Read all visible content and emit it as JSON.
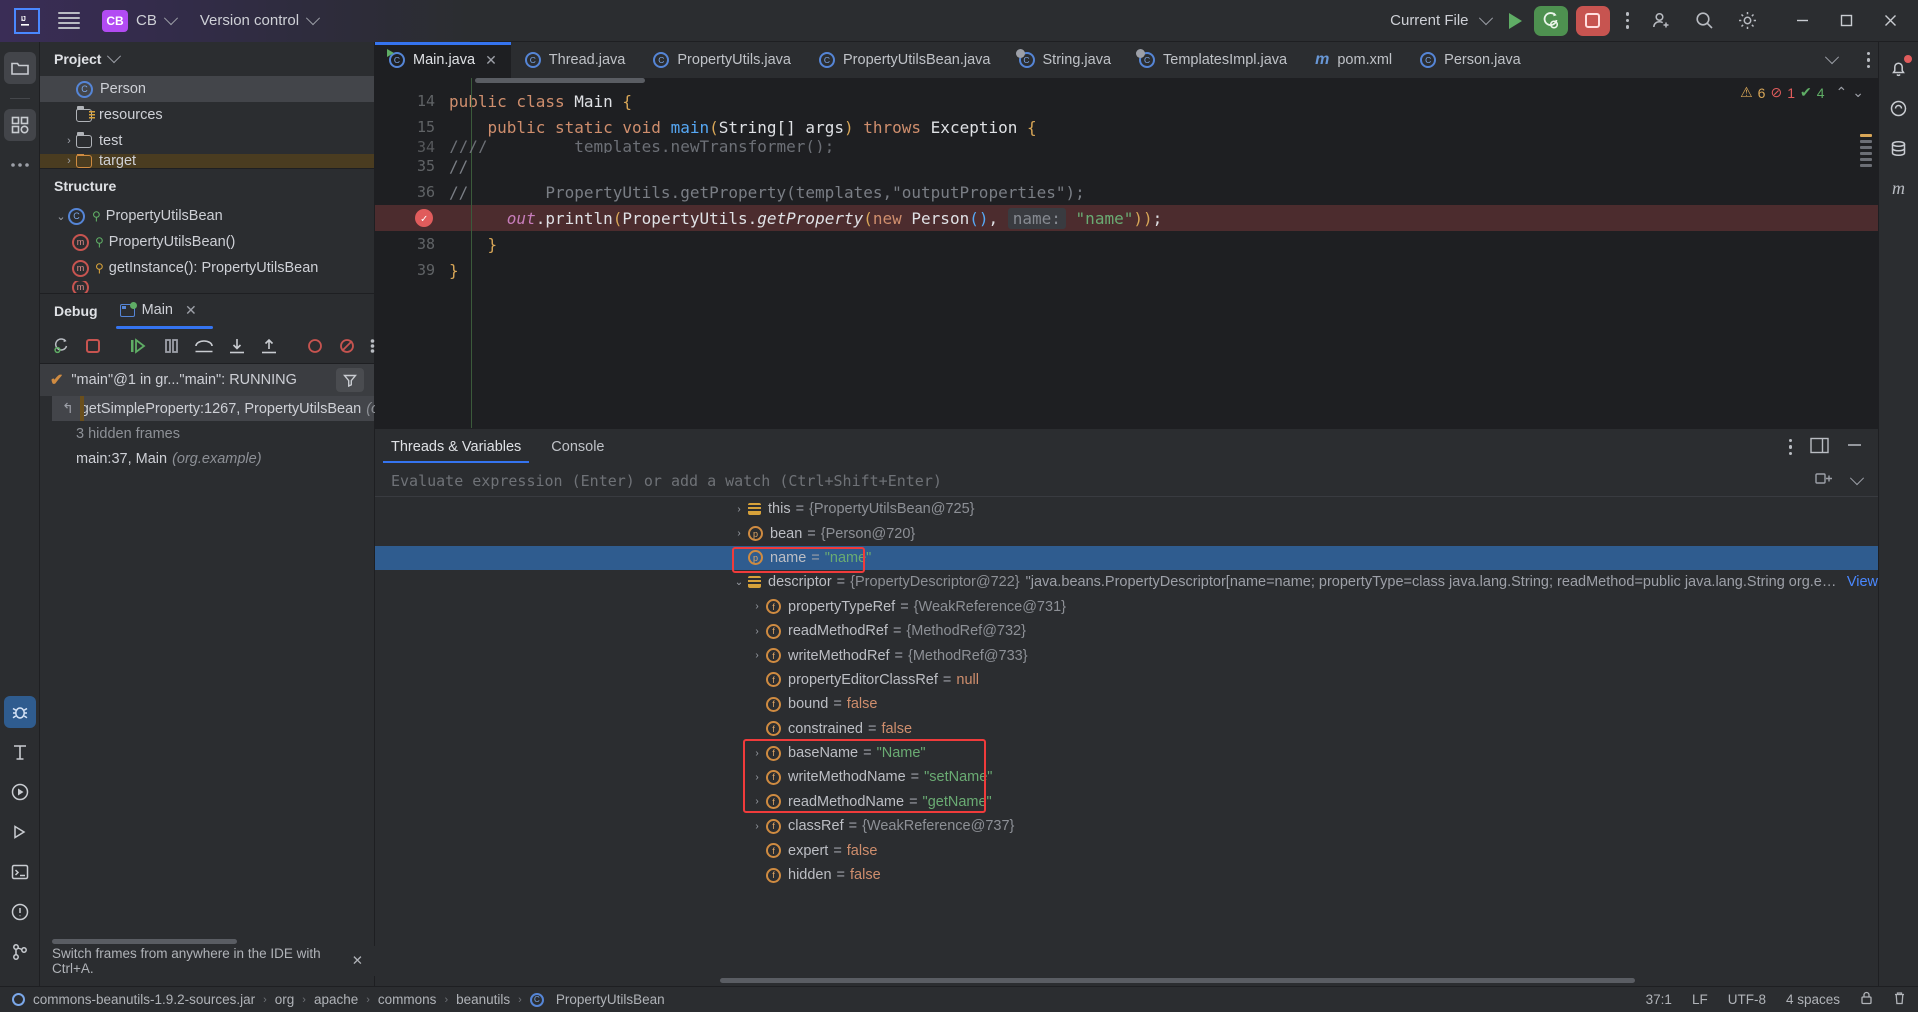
{
  "titlebar": {
    "logo": "IJ",
    "menu_icon": "hamburger-menu-icon",
    "project_badge": "CB",
    "project_name": "CB",
    "vcs_label": "Version control",
    "run_config": "Current File",
    "run_icon": "run-triangle-icon",
    "debug_icon": "debug-bug-icon",
    "stop_icon": "stop-square-icon",
    "more_icon": "more-vertical-icon",
    "account_icon": "account-add-icon",
    "search_icon": "search-icon",
    "settings_icon": "gear-icon",
    "minimize": "—",
    "maximize": "❐",
    "close": "✕",
    "accent_green": "#4e9150",
    "accent_red": "#c75450",
    "accent_purple": "#b24bf3"
  },
  "rail": {
    "project_icon": "folder-icon",
    "structure_icon": "structure-grid-icon",
    "more_icon": "more-horizontal-icon",
    "debug_icon": "debug-bug-icon",
    "todo_icon": "todo-icon",
    "run_icon": "run-icon",
    "services_icon": "services-play-icon",
    "terminal_icon": "terminal-icon",
    "problems_icon": "problems-warning-icon",
    "vcs_icon": "git-branch-icon"
  },
  "project_panel": {
    "title": "Project",
    "chevron": "chevron-down-icon",
    "items": [
      {
        "label": "Person",
        "icon": "class-icon",
        "indent": 2,
        "state": "selected",
        "arrow": ""
      },
      {
        "label": "resources",
        "icon": "resource-folder-icon",
        "indent": 2,
        "state": "normal",
        "arrow": ""
      },
      {
        "label": "test",
        "icon": "folder-icon",
        "indent": 1,
        "state": "normal",
        "arrow": "›"
      },
      {
        "label": "target",
        "icon": "folder-orange-icon",
        "indent": 1,
        "state": "highlighted",
        "arrow": "›"
      }
    ]
  },
  "structure_panel": {
    "title": "Structure",
    "items": [
      {
        "label": "PropertyUtilsBean",
        "icon": "class-icon",
        "visibility": "public-key-icon",
        "indent": 0,
        "arrow": "⌄"
      },
      {
        "label": "PropertyUtilsBean()",
        "icon": "method-icon",
        "visibility": "public-key-icon",
        "indent": 1,
        "arrow": ""
      },
      {
        "label": "getInstance(): PropertyUtilsBean",
        "icon": "method-icon",
        "visibility": "protected-key-icon",
        "indent": 1,
        "arrow": ""
      }
    ]
  },
  "debug_panel": {
    "title": "Debug",
    "tab_label": "Main",
    "tab_icon": "run-config-icon",
    "tab_close": "✕",
    "toolbar": [
      {
        "name": "rerun-button",
        "icon": "rerun-icon"
      },
      {
        "name": "stop-button",
        "icon": "stop-icon"
      },
      {
        "name": "resume-button",
        "icon": "resume-icon"
      },
      {
        "name": "pause-button",
        "icon": "pause-icon"
      },
      {
        "name": "step-over-button",
        "icon": "step-over-icon"
      },
      {
        "name": "step-into-button",
        "icon": "step-into-icon"
      },
      {
        "name": "step-out-button",
        "icon": "step-out-icon"
      },
      {
        "name": "mute-breakpoints-button",
        "icon": "breakpoint-circle-icon"
      },
      {
        "name": "view-breakpoints-button",
        "icon": "breakpoint-muted-icon"
      },
      {
        "name": "more-button",
        "icon": "more-vertical-icon"
      }
    ],
    "thread_row": "\"main\"@1 in gr...\"main\": RUNNING",
    "thread_check": "✔",
    "filter_icon": "filter-icon",
    "frames": [
      {
        "label": "getSimpleProperty:1267, PropertyUtilsBean",
        "suffix": "(org",
        "state": "selected"
      },
      {
        "label": "3 hidden frames",
        "suffix": "",
        "state": "dim"
      },
      {
        "label": "main:37, Main",
        "suffix": "(org.example)",
        "state": "normal"
      }
    ],
    "tip_text": "Switch frames from anywhere in the IDE with Ctrl+A.",
    "tip_close": "✕"
  },
  "editor": {
    "tabs": [
      {
        "label": "Main.java",
        "icon": "java-class-run-icon",
        "active": true,
        "closable": true
      },
      {
        "label": "Thread.java",
        "icon": "java-class-icon",
        "active": false,
        "closable": false
      },
      {
        "label": "PropertyUtils.java",
        "icon": "java-class-icon",
        "active": false,
        "closable": false
      },
      {
        "label": "PropertyUtilsBean.java",
        "icon": "java-class-icon",
        "active": false,
        "closable": false
      },
      {
        "label": "String.java",
        "icon": "java-class-lib-icon",
        "active": false,
        "closable": false
      },
      {
        "label": "TemplatesImpl.java",
        "icon": "java-class-lib-icon",
        "active": false,
        "closable": false
      },
      {
        "label": "pom.xml",
        "icon": "maven-icon",
        "active": false,
        "closable": false
      },
      {
        "label": "Person.java",
        "icon": "java-class-icon",
        "active": false,
        "closable": false
      }
    ],
    "tabs_overflow_icon": "chevron-down-icon",
    "tabs_more_icon": "more-vertical-icon",
    "notification_icon": "bell-icon",
    "inspections": {
      "warnings": "6",
      "errors": "1",
      "checks": "4",
      "warning_icon": "warning-triangle-icon",
      "error_icon": "error-circle-icon",
      "ok_icon": "check-icon",
      "up_icon": "chevron-up-icon",
      "down_icon": "chevron-down-icon"
    },
    "lines": [
      {
        "num": "14",
        "breakpoint": false,
        "tokens": [
          {
            "t": "public ",
            "c": "k"
          },
          {
            "t": "class ",
            "c": "k"
          },
          {
            "t": "Main ",
            "c": ""
          },
          {
            "t": "{",
            "c": "y"
          }
        ]
      },
      {
        "num": "15",
        "breakpoint": false,
        "indent": 2,
        "tokens": [
          {
            "t": "public ",
            "c": "k"
          },
          {
            "t": "static ",
            "c": "k"
          },
          {
            "t": "void ",
            "c": "k"
          },
          {
            "t": "main",
            "c": "fn"
          },
          {
            "t": "(",
            "c": "y"
          },
          {
            "t": "String[] args",
            "c": ""
          },
          {
            "t": ")",
            "c": "y"
          },
          {
            "t": " throws ",
            "c": "k"
          },
          {
            "t": "Exception ",
            "c": ""
          },
          {
            "t": "{",
            "c": "y"
          }
        ]
      },
      {
        "num": "34",
        "breakpoint": false,
        "clipped": true,
        "tokens": [
          {
            "t": "////         templates.newTransformer();",
            "c": "g"
          }
        ]
      },
      {
        "num": "35",
        "breakpoint": false,
        "tokens": [
          {
            "t": "//",
            "c": "g"
          }
        ]
      },
      {
        "num": "36",
        "breakpoint": false,
        "tokens": [
          {
            "t": "//         PropertyUtils.getProperty(templates,\"outputProperties\");",
            "c": "g"
          }
        ]
      },
      {
        "num": "37",
        "breakpoint": true,
        "indent": 4,
        "tokens": [
          {
            "t": "out",
            "c": "p"
          },
          {
            "t": ".println",
            "c": ""
          },
          {
            "t": "(",
            "c": "y"
          },
          {
            "t": "PropertyUtils.",
            "c": ""
          },
          {
            "t": "getProperty",
            "c": "ital"
          },
          {
            "t": "(",
            "c": "y"
          },
          {
            "t": "new ",
            "c": "k"
          },
          {
            "t": "Person",
            "c": ""
          },
          {
            "t": "()",
            "c": "fn"
          },
          {
            "t": ", ",
            "c": ""
          },
          {
            "t": "name:",
            "c": "hint"
          },
          {
            "t": " ",
            "c": ""
          },
          {
            "t": "\"name\"",
            "c": "s"
          },
          {
            "t": "))",
            "c": "y"
          },
          {
            "t": ";",
            "c": ""
          }
        ]
      },
      {
        "num": "38",
        "breakpoint": false,
        "indent": 2,
        "tokens": [
          {
            "t": "}",
            "c": "y"
          }
        ]
      },
      {
        "num": "39",
        "breakpoint": false,
        "tokens": [
          {
            "t": "}",
            "c": "y"
          }
        ]
      }
    ]
  },
  "variables_panel": {
    "tabs": [
      {
        "label": "Threads & Variables",
        "active": true
      },
      {
        "label": "Console",
        "active": false
      }
    ],
    "layout_icon": "layout-panel-icon",
    "eval_placeholder": "Evaluate expression (Enter) or add a watch (Ctrl+Shift+Enter)",
    "eval_add_icon": "add-watch-icon",
    "eval_chevron": "chevron-down-icon",
    "rows": [
      {
        "arrow": "›",
        "icon": "object-icon",
        "name": "this",
        "eq": "=",
        "value": "{PropertyUtilsBean@725}",
        "vclass": "vval-obj",
        "indent": 0,
        "state": "normal"
      },
      {
        "arrow": "›",
        "icon": "param-icon",
        "name": "bean",
        "eq": "=",
        "value": "{Person@720}",
        "vclass": "vval-obj",
        "indent": 0,
        "state": "normal"
      },
      {
        "arrow": "",
        "icon": "param-icon",
        "name": "name",
        "eq": "=",
        "value": "\"name\"",
        "vclass": "vval-str",
        "indent": 0,
        "state": "selected",
        "boxed": true
      },
      {
        "arrow": "⌄",
        "icon": "object-icon",
        "name": "descriptor",
        "eq": "=",
        "value": "{PropertyDescriptor@722}",
        "vclass": "vval-obj",
        "indent": 0,
        "state": "normal",
        "extra": "\"java.beans.PropertyDescriptor[name=name; propertyType=class java.lang.String; readMethod=public java.lang.String org.example.Person.getName(); writeMeth…",
        "link": "View"
      },
      {
        "arrow": "›",
        "icon": "field-icon",
        "name": "propertyTypeRef",
        "eq": "=",
        "value": "{WeakReference@731}",
        "vclass": "vval-obj",
        "indent": 1,
        "state": "normal"
      },
      {
        "arrow": "›",
        "icon": "field-icon",
        "name": "readMethodRef",
        "eq": "=",
        "value": "{MethodRef@732}",
        "vclass": "vval-obj",
        "indent": 1,
        "state": "normal"
      },
      {
        "arrow": "›",
        "icon": "field-icon",
        "name": "writeMethodRef",
        "eq": "=",
        "value": "{MethodRef@733}",
        "vclass": "vval-obj",
        "indent": 1,
        "state": "normal"
      },
      {
        "arrow": "",
        "icon": "field-icon",
        "name": "propertyEditorClassRef",
        "eq": "=",
        "value": "null",
        "vclass": "vval-kw",
        "indent": 1,
        "state": "normal"
      },
      {
        "arrow": "",
        "icon": "field-icon",
        "name": "bound",
        "eq": "=",
        "value": "false",
        "vclass": "vval-kw",
        "indent": 1,
        "state": "normal"
      },
      {
        "arrow": "",
        "icon": "field-icon",
        "name": "constrained",
        "eq": "=",
        "value": "false",
        "vclass": "vval-kw",
        "indent": 1,
        "state": "normal"
      },
      {
        "arrow": "›",
        "icon": "field-icon",
        "name": "baseName",
        "eq": "=",
        "value": "\"Name\"",
        "vclass": "vval-str",
        "indent": 1,
        "state": "normal"
      },
      {
        "arrow": "›",
        "icon": "field-icon",
        "name": "writeMethodName",
        "eq": "=",
        "value": "\"setName\"",
        "vclass": "vval-str",
        "indent": 1,
        "state": "normal"
      },
      {
        "arrow": "›",
        "icon": "field-icon",
        "name": "readMethodName",
        "eq": "=",
        "value": "\"getName\"",
        "vclass": "vval-str",
        "indent": 1,
        "state": "normal"
      },
      {
        "arrow": "›",
        "icon": "field-icon",
        "name": "classRef",
        "eq": "=",
        "value": "{WeakReference@737}",
        "vclass": "vval-obj",
        "indent": 1,
        "state": "normal"
      },
      {
        "arrow": "",
        "icon": "field-icon",
        "name": "expert",
        "eq": "=",
        "value": "false",
        "vclass": "vval-kw",
        "indent": 1,
        "state": "normal"
      },
      {
        "arrow": "",
        "icon": "field-icon",
        "name": "hidden",
        "eq": "=",
        "value": "false",
        "vclass": "vval-kw",
        "indent": 1,
        "state": "normal"
      }
    ],
    "highlight_color": "#f03b3b"
  },
  "status_bar": {
    "jar_label": "commons-beanutils-1.9.2-sources.jar",
    "breadcrumbs": [
      "org",
      "apache",
      "commons",
      "beanutils",
      "PropertyUtilsBean"
    ],
    "separator": "›",
    "caret": "37:1",
    "line_sep": "LF",
    "encoding": "UTF-8",
    "indent": "4 spaces",
    "lock_icon": "lock-icon",
    "trash_icon": "trash-icon"
  },
  "right_rail": {
    "notifications_icon": "bell-icon",
    "ai_icon": "ai-assistant-icon",
    "database_icon": "database-icon",
    "maven_icon": "maven-m-icon"
  }
}
